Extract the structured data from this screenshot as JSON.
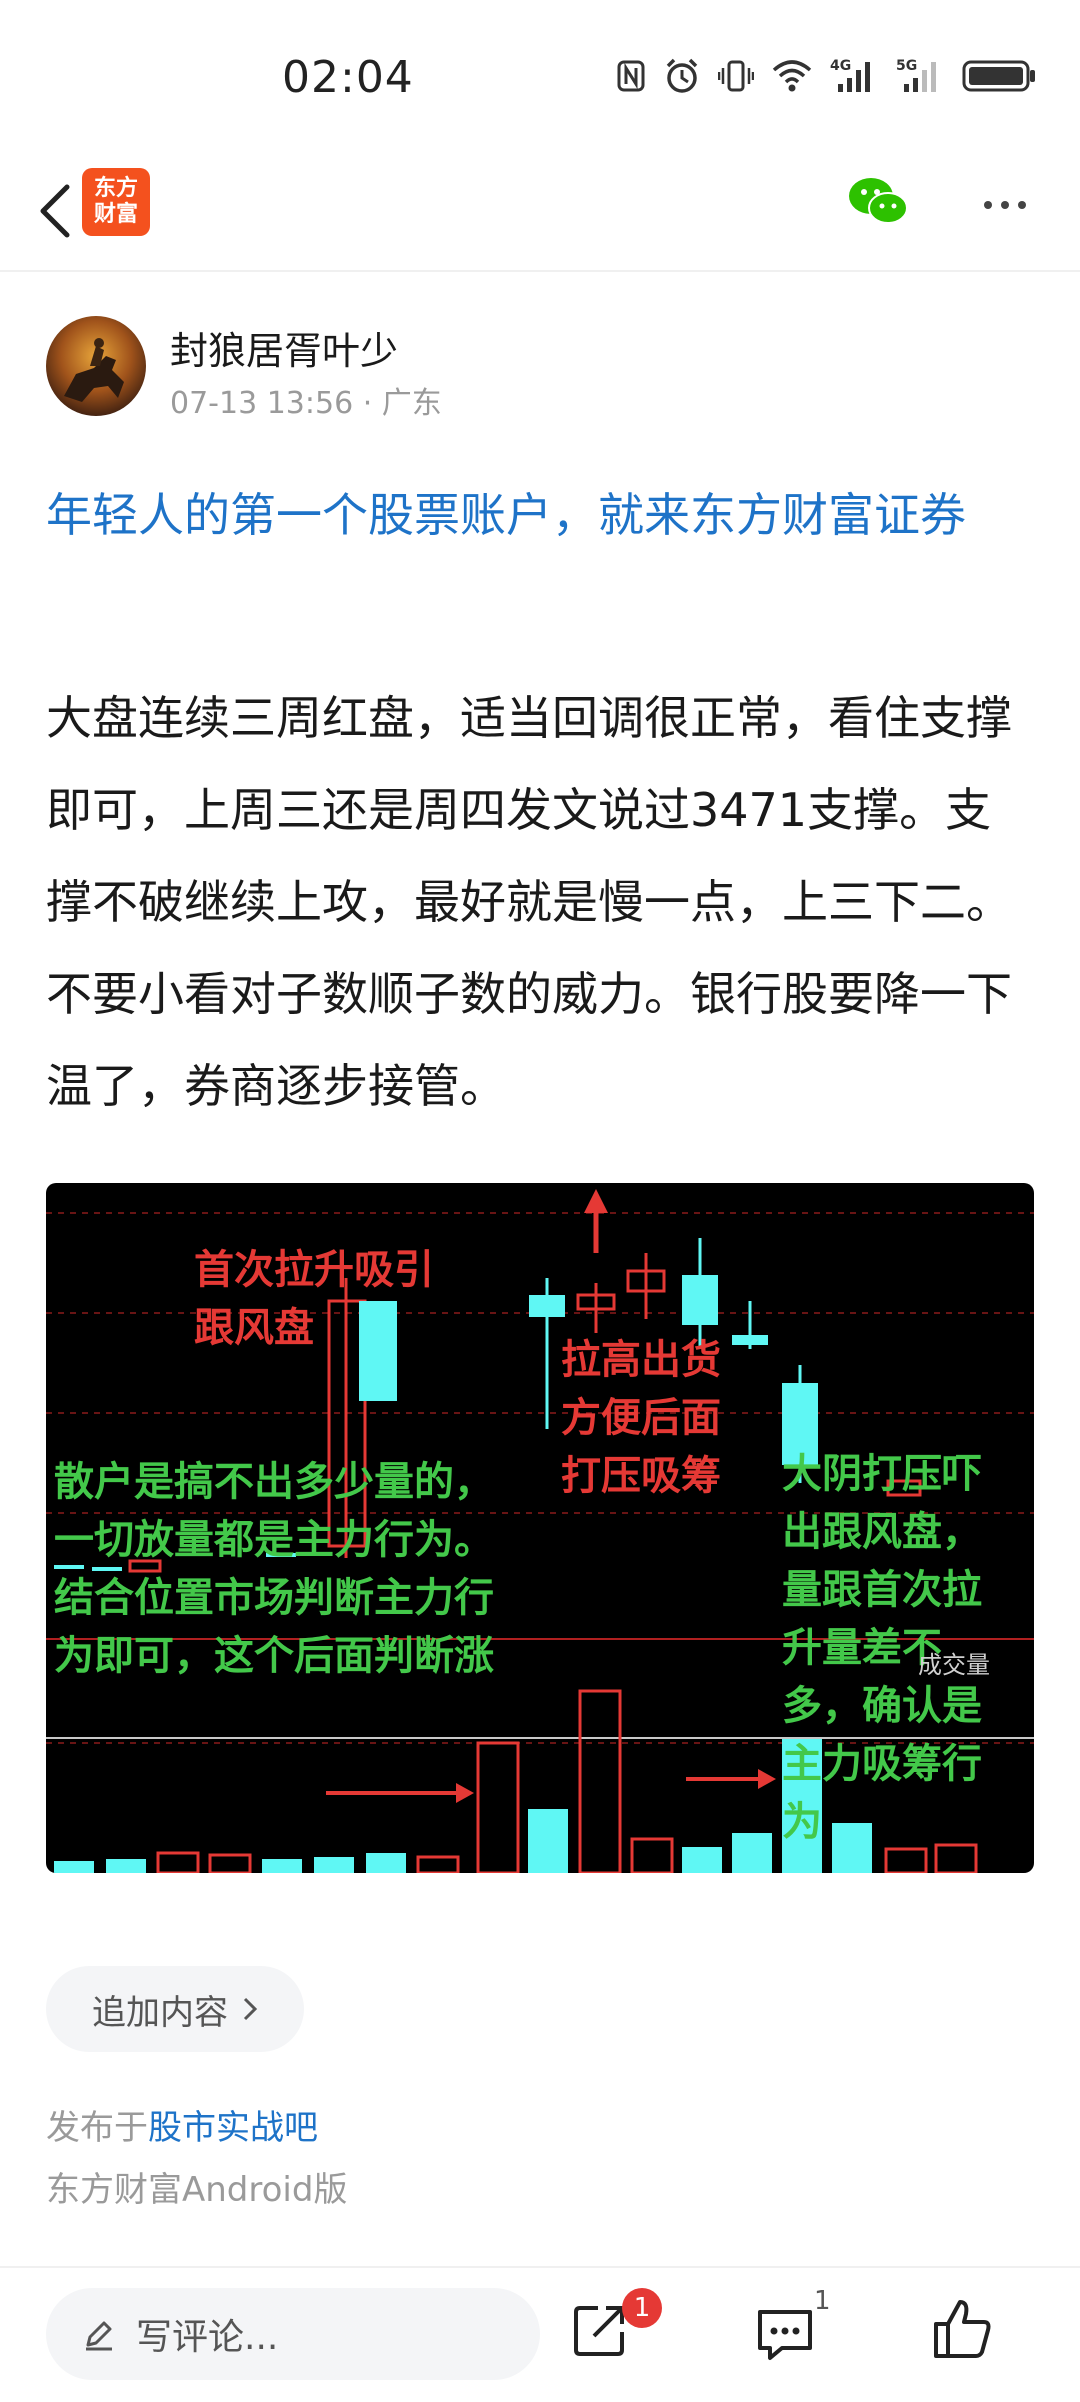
{
  "status_bar": {
    "time": "02:04",
    "network_4g": "4G",
    "network_5g": "5G"
  },
  "nav": {
    "logo_line1": "东方",
    "logo_line2": "财富"
  },
  "author": {
    "name": "封狼居胥叶少",
    "meta": "07-13 13:56 · 广东"
  },
  "ad_link": "年轻人的第一个股票账户，就来东方财富证券",
  "body_text": "大盘连续三周红盘，适当回调很正常，看住支撑即可，上周三还是周四发文说过3471支撑。支撑不破继续上攻，最好就是慢一点，上三下二。不要小看对子数顺子数的威力。银行股要降一下温了，券商逐步接管。",
  "chart_image": {
    "annotations": {
      "first_pull": "首次拉升吸引\n跟风盘",
      "pull_high": "拉高出货\n方便后面\n打压吸筹",
      "retail": "散户是搞不出多少量的，\n一切放量都是主力行为。\n结合位置市场判断主力行\n为即可，这个后面判断涨",
      "big_yin": "大阴打压吓\n出跟风盘，\n量跟首次拉\n升量差不\n多，确认是\n主力吸筹行\n为"
    },
    "volume_label": "成交量",
    "colors": {
      "up": "#e53935",
      "down": "#5ff7f4",
      "annotation_red": "#e53935",
      "annotation_green": "#43c84a"
    }
  },
  "append_button": "追加内容",
  "published": {
    "prefix": "发布于",
    "forum": "股市实战吧"
  },
  "client": "东方财富Android版",
  "bottom_bar": {
    "comment_placeholder": "写评论...",
    "share_badge": "1",
    "comment_count": "1"
  }
}
